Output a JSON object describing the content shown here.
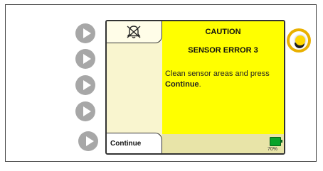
{
  "screen": {
    "alarm_tab_icon": "alarm-silenced-bell-icon",
    "alert_title": "CAUTION",
    "alert_subtitle": "SENSOR ERROR 3",
    "message_part1": "Clean sensor areas and press ",
    "message_bold": "Continue",
    "message_end": ".",
    "continue_label": "Continue",
    "battery_percent": "70%",
    "battery_level": 0.7
  },
  "softkeys": [
    {
      "icon": "softkey-arrow-icon"
    },
    {
      "icon": "softkey-arrow-icon"
    },
    {
      "icon": "softkey-arrow-icon"
    },
    {
      "icon": "softkey-arrow-icon"
    },
    {
      "icon": "softkey-arrow-icon"
    }
  ],
  "indicator": {
    "icon": "alert-indicator-light-icon"
  },
  "colors": {
    "alert_background": "#ffff00",
    "panel_background": "#f9f5cf",
    "softkey": "#a7a7a7",
    "indicator_ring": "#e9b000",
    "battery": "#0aa32a"
  }
}
